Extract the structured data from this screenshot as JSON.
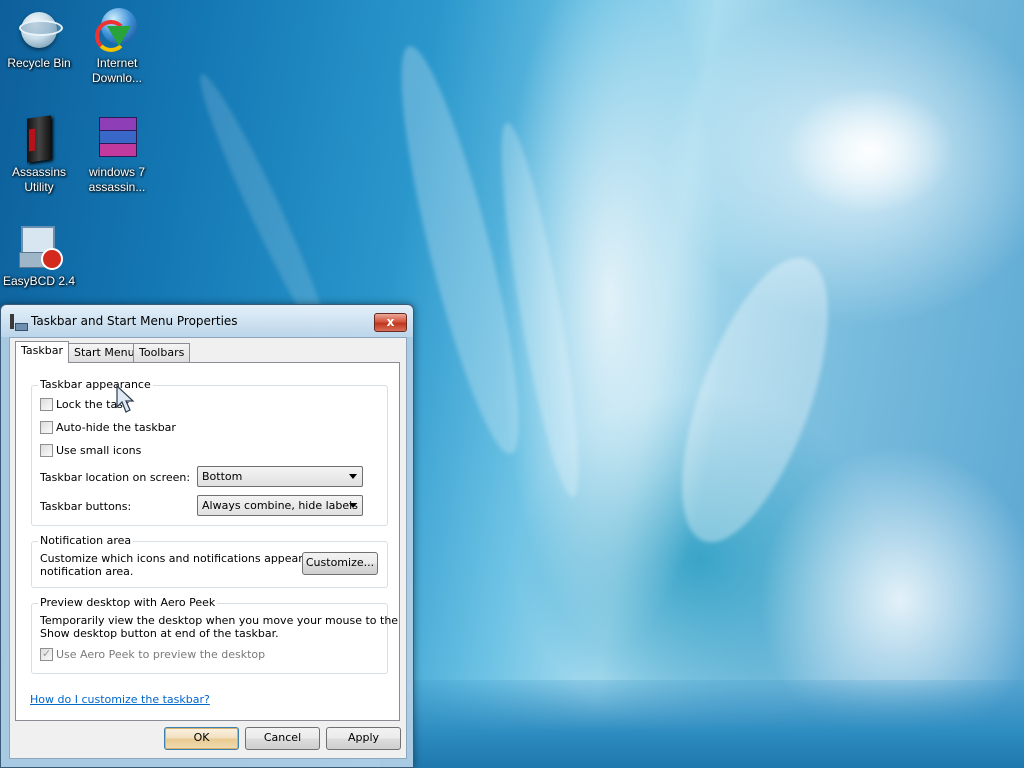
{
  "desktop": {
    "icons": [
      {
        "label_line1": "Recycle Bin",
        "label_line2": "",
        "icon": "recycle-bin-icon"
      },
      {
        "label_line1": "Internet",
        "label_line2": "Downlo...",
        "icon": "internet-download-manager-icon"
      },
      {
        "label_line1": "Assassins",
        "label_line2": "Utility",
        "icon": "assassins-utility-icon"
      },
      {
        "label_line1": "windows 7",
        "label_line2": "assassin...",
        "icon": "winrar-archive-icon"
      },
      {
        "label_line1": "EasyBCD 2.4",
        "label_line2": "",
        "icon": "easybcd-icon"
      }
    ]
  },
  "dialog": {
    "title": "Taskbar and Start Menu Properties",
    "close_label": "x",
    "tabs": [
      {
        "label": "Taskbar",
        "active": true
      },
      {
        "label": "Start Menu",
        "active": false
      },
      {
        "label": "Toolbars",
        "active": false
      }
    ],
    "appearance": {
      "group_title": "Taskbar appearance",
      "lock_label": "Lock the task",
      "lock_checked": false,
      "autohide_label": "Auto-hide the taskbar",
      "autohide_checked": false,
      "small_icons_label": "Use small icons",
      "small_icons_checked": false,
      "location_label": "Taskbar location on screen:",
      "location_value": "Bottom",
      "buttons_label": "Taskbar buttons:",
      "buttons_value": "Always combine, hide labels"
    },
    "notification": {
      "group_title": "Notification area",
      "description_line1": "Customize which icons and notifications appear in the",
      "description_line2": "notification area.",
      "customize_label": "Customize..."
    },
    "aero_peek": {
      "group_title": "Preview desktop with Aero Peek",
      "description_line1": "Temporarily view the desktop when you move your mouse to the",
      "description_line2": "Show desktop button at end of the taskbar.",
      "checkbox_label": "Use Aero Peek to preview the desktop",
      "checkbox_checked": true,
      "checkbox_disabled": true
    },
    "help_link": "How do I customize the taskbar?",
    "buttons": {
      "ok": "OK",
      "cancel": "Cancel",
      "apply": "Apply"
    }
  }
}
